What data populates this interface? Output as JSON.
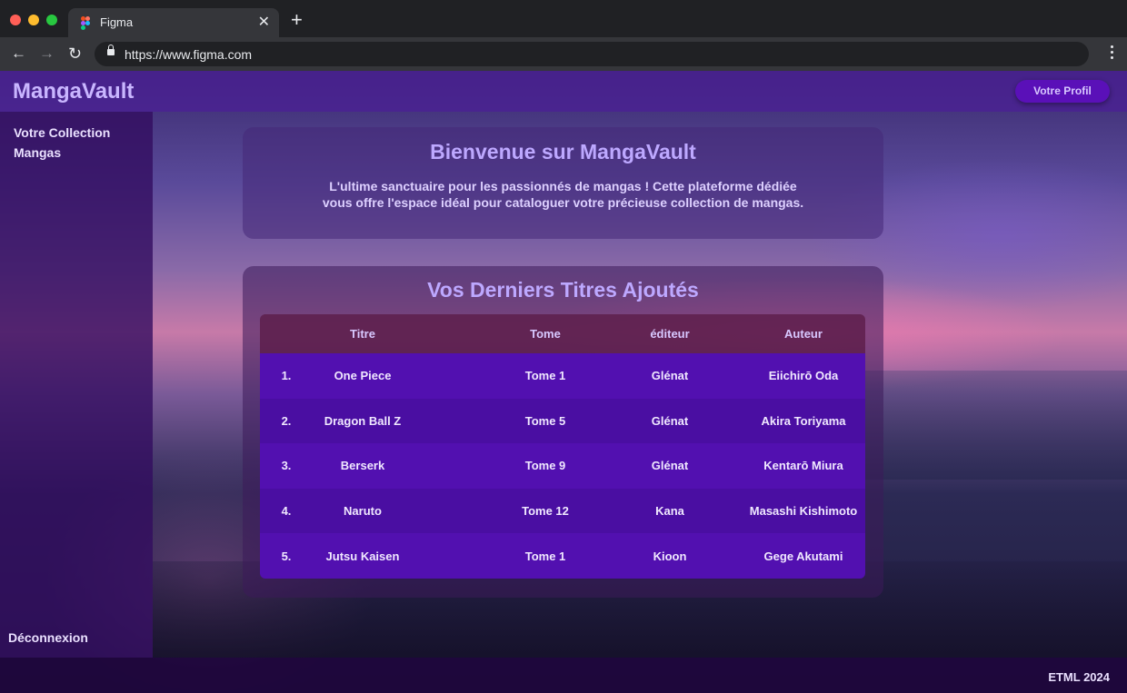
{
  "browser": {
    "tab_title": "Figma",
    "tab_close": "✕",
    "new_tab": "+",
    "url": "https://www.figma.com",
    "nav_back": "←",
    "nav_forward": "→",
    "nav_reload": "↻"
  },
  "header": {
    "brand": "MangaVault",
    "profile_button": "Votre Profil"
  },
  "sidebar": {
    "collection_link": "Votre Collection Mangas",
    "logout": "Déconnexion"
  },
  "welcome": {
    "title": "Bienvenue sur MangaVault",
    "text": "L'ultime sanctuaire pour les passionnés de mangas ! Cette plateforme dédiée vous offre l'espace idéal pour cataloguer votre précieuse collection de mangas."
  },
  "recent": {
    "title": "Vos Derniers Titres Ajoutés",
    "columns": [
      "Titre",
      "Tome",
      "éditeur",
      "Auteur"
    ],
    "rows": [
      {
        "num": "1.",
        "title": "One Piece",
        "tome": "Tome 1",
        "publisher": "Glénat",
        "author": "Eiichirō Oda"
      },
      {
        "num": "2.",
        "title": "Dragon Ball Z",
        "tome": "Tome 5",
        "publisher": "Glénat",
        "author": "Akira Toriyama"
      },
      {
        "num": "3.",
        "title": "Berserk",
        "tome": "Tome 9",
        "publisher": "Glénat",
        "author": "Kentarō Miura"
      },
      {
        "num": "4.",
        "title": "Naruto",
        "tome": "Tome 12",
        "publisher": "Kana",
        "author": "Masashi Kishimoto"
      },
      {
        "num": "5.",
        "title": "Jutsu Kaisen",
        "tome": "Tome 1",
        "publisher": "Kioon",
        "author": "Gege Akutami"
      }
    ]
  },
  "footer": {
    "text": "ETML 2024"
  },
  "colors": {
    "brand": "#c9b6ff",
    "header_bg": "#4b1e96",
    "button": "#5a10b8",
    "row": "#5210b0"
  }
}
